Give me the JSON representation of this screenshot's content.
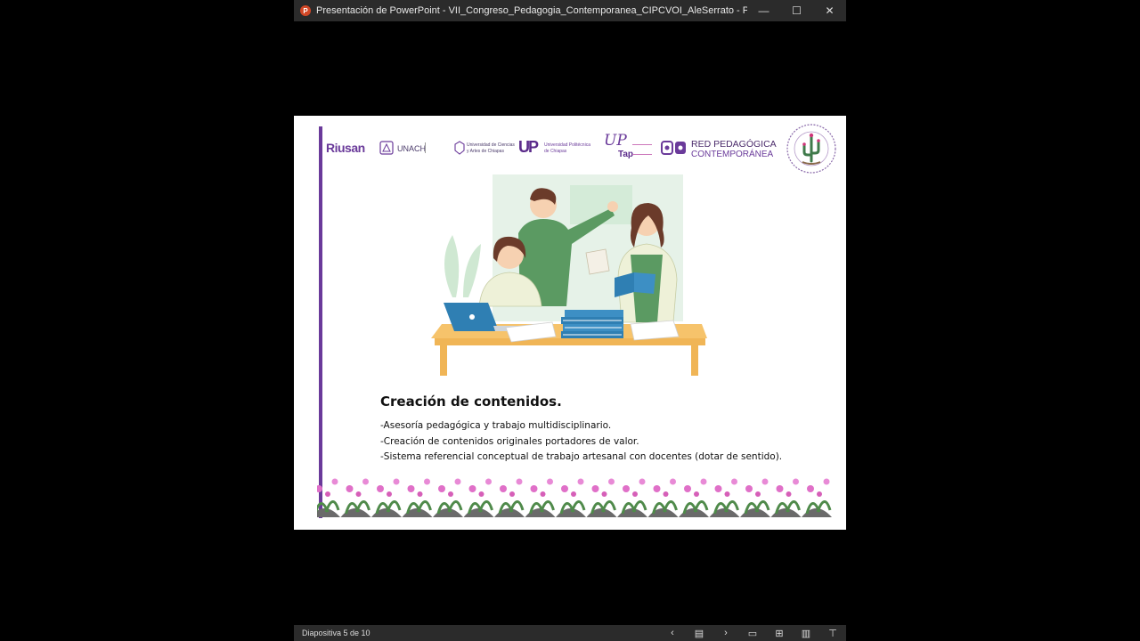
{
  "window": {
    "title": "Presentación de PowerPoint  -  VII_Congreso_Pedagogia_Contemporanea_CIPCVOI_AleSerrato - PowerPoint",
    "app_icon": "powerpoint-icon",
    "minimize_glyph": "—",
    "maximize_glyph": "☐",
    "close_glyph": "✕"
  },
  "logos": {
    "riusan": "Riusan",
    "unach": "UNACH",
    "unicach_line1": "Universidad de Ciencias",
    "unicach_line2": "y Artes de Chiapas",
    "up_mark": "UP",
    "up_line1": "Universidad Politécnica",
    "up_line2": "de Chiapas",
    "uptap_script": "UP",
    "uptap_tap": "Tap",
    "red_line1": "RED PEDAGÓGICA",
    "red_line2": "CONTEMPORÁNEA"
  },
  "slide": {
    "heading": "Creación de contenidos.",
    "bullets": [
      "-Asesoría pedagógica y trabajo multidisciplinario.",
      "-Creación de contenidos originales portadores de valor.",
      "-Sistema referencial conceptual de trabajo artesanal con docentes (dotar de sentido)."
    ]
  },
  "status": {
    "slide_counter": "Diapositiva 5 de 10",
    "icons": [
      "prev-slide-icon",
      "notes-icon",
      "next-slide-icon",
      "normal-view-icon",
      "slide-sorter-icon",
      "reading-view-icon",
      "slideshow-icon"
    ]
  },
  "colors": {
    "accent_purple": "#6a3a9a",
    "titlebar_bg": "#2b2b2b"
  }
}
